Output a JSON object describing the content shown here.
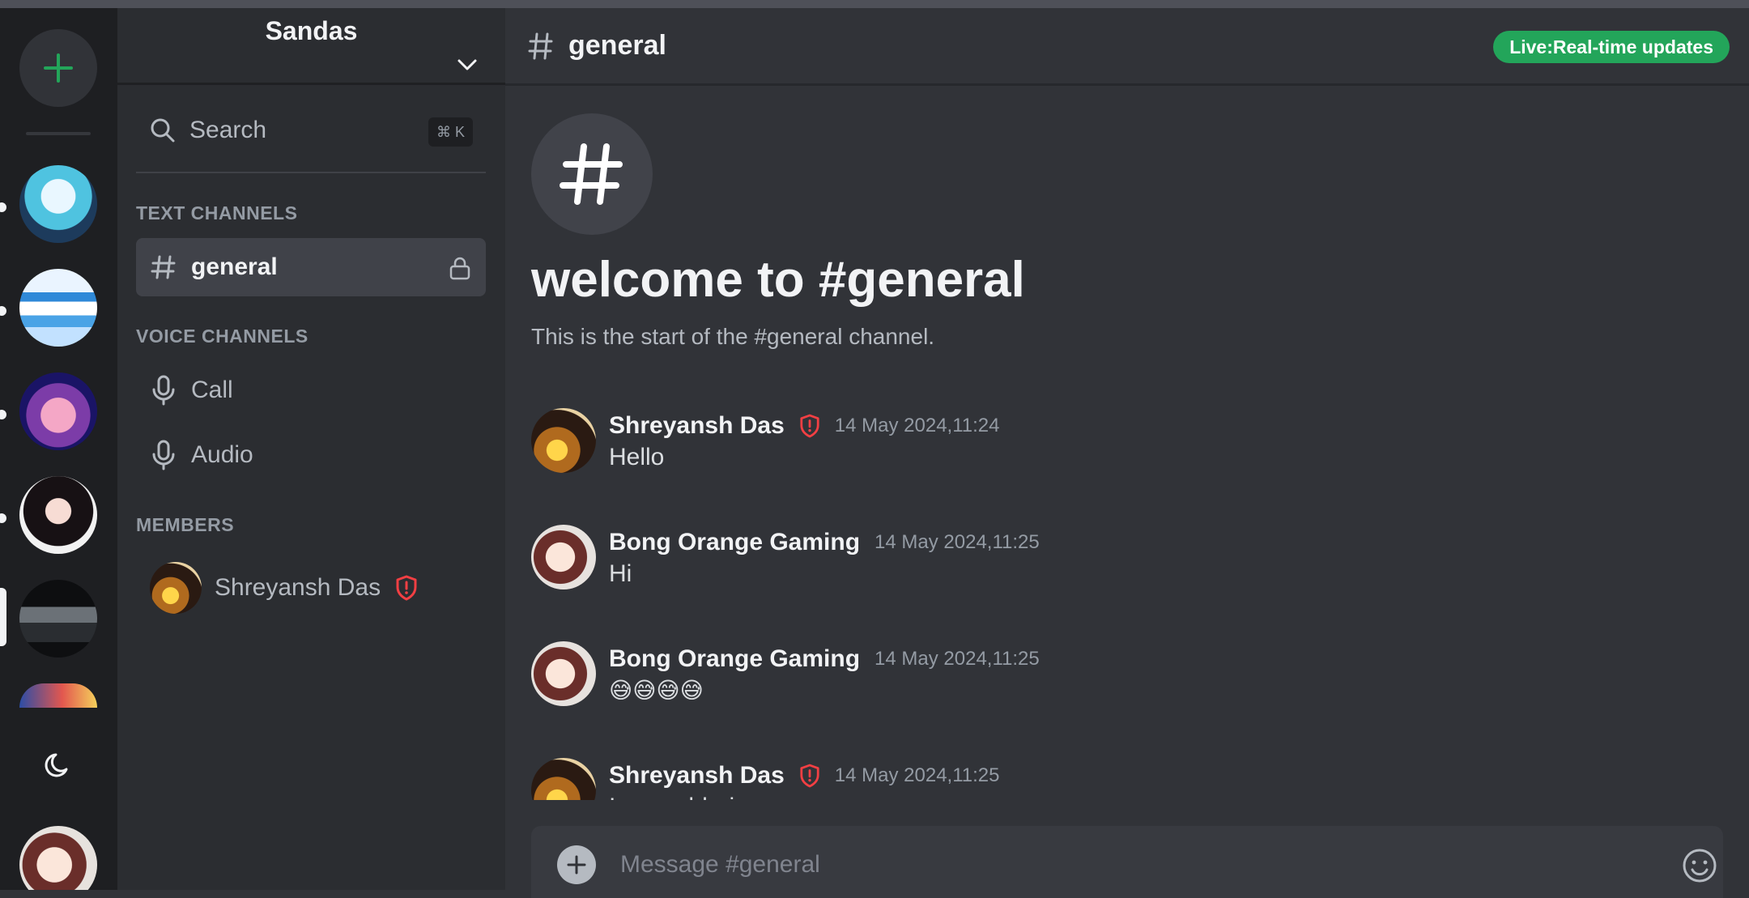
{
  "server": {
    "name": "Sandas"
  },
  "search": {
    "label": "Search",
    "shortcut": "⌘ K"
  },
  "sections": {
    "text": "TEXT CHANNELS",
    "voice": "VOICE CHANNELS",
    "members": "MEMBERS"
  },
  "text_channels": [
    {
      "name": "general",
      "active": true,
      "locked": true
    }
  ],
  "voice_channels": [
    {
      "name": "Call"
    },
    {
      "name": "Audio"
    }
  ],
  "members": [
    {
      "name": "Shreyansh Das",
      "role_icon": "shield-icon",
      "role_color": "#f23f43"
    }
  ],
  "channel": {
    "name": "general",
    "live_badge": "Live:Real-time updates",
    "welcome_title": "welcome to #general",
    "welcome_sub": "This is the start of the #general channel."
  },
  "messages": [
    {
      "author": "Shreyansh Das",
      "shield": true,
      "time": "14 May 2024,11:24",
      "text": "Hello"
    },
    {
      "author": "Bong Orange Gaming",
      "shield": false,
      "time": "14 May 2024,11:25",
      "text": "Hi"
    },
    {
      "author": "Bong Orange Gaming",
      "shield": false,
      "time": "14 May 2024,11:25",
      "text": "😅😅😅😅"
    },
    {
      "author": "Shreyansh Das",
      "shield": true,
      "time": "14 May 2024,11:25",
      "text": "Insane bhai"
    }
  ],
  "composer": {
    "placeholder": "Message #general"
  },
  "colors": {
    "accent_green": "#23a55a",
    "shield_red": "#f23f43",
    "background": "#313338",
    "sidebar": "#2b2d31",
    "rail": "#1e1f22"
  }
}
